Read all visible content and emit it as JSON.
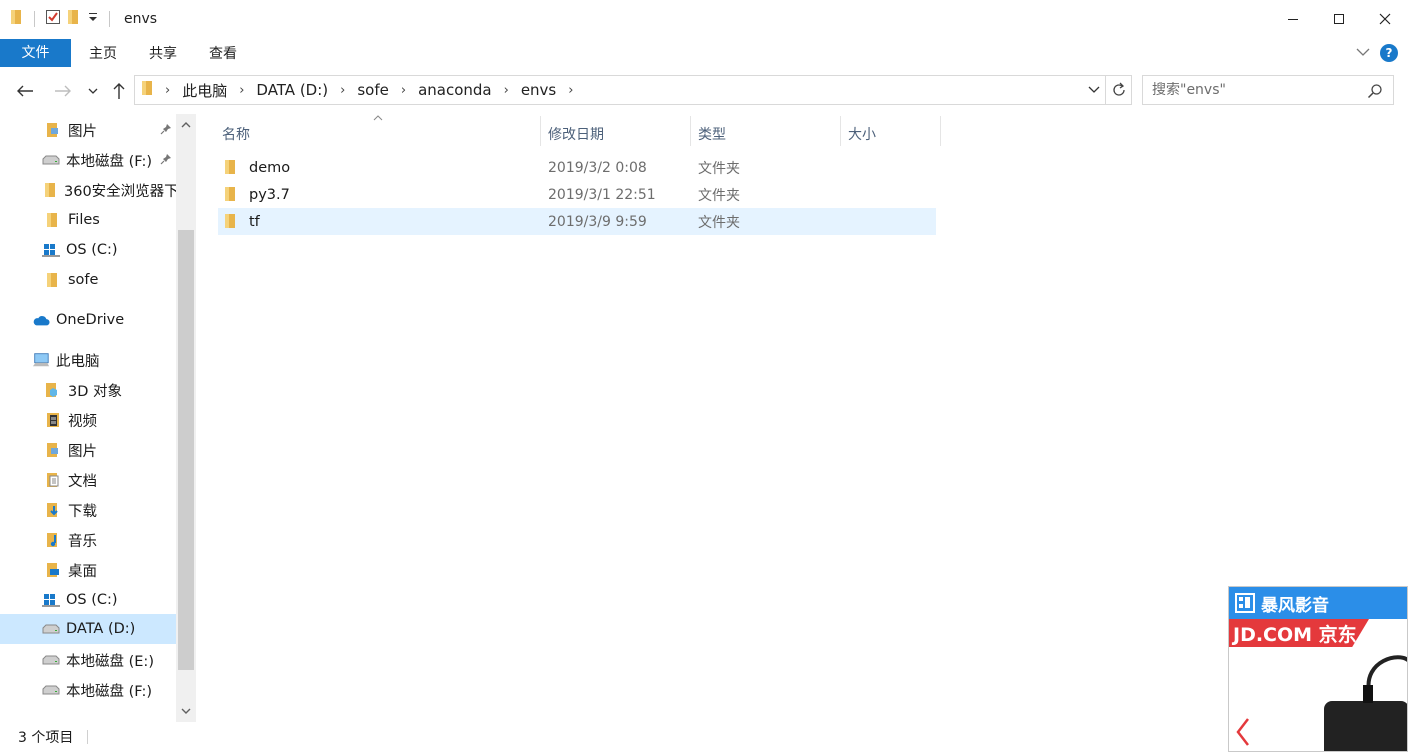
{
  "window": {
    "title": "envs"
  },
  "ribbon": {
    "tabs": [
      {
        "label": "文件"
      },
      {
        "label": "主页"
      },
      {
        "label": "共享"
      },
      {
        "label": "查看"
      }
    ]
  },
  "address": {
    "crumbs": [
      "此电脑",
      "DATA (D:)",
      "sofe",
      "anaconda",
      "envs"
    ]
  },
  "search": {
    "placeholder": "搜索\"envs\""
  },
  "nav": {
    "items": [
      {
        "label": "图片",
        "icon": "pictures-folder-icon",
        "pinned": true
      },
      {
        "label": "本地磁盘 (F:)",
        "icon": "drive-icon",
        "pinned": true
      },
      {
        "label": "360安全浏览器下",
        "icon": "folder-icon"
      },
      {
        "label": "Files",
        "icon": "folder-icon"
      },
      {
        "label": "OS (C:)",
        "icon": "windows-drive-icon"
      },
      {
        "label": "sofe",
        "icon": "folder-icon"
      },
      {
        "label": "OneDrive",
        "icon": "onedrive-cloud-icon"
      },
      {
        "label": "此电脑",
        "icon": "this-pc-icon"
      },
      {
        "label": "3D 对象",
        "icon": "3d-objects-icon"
      },
      {
        "label": "视频",
        "icon": "videos-icon"
      },
      {
        "label": "图片",
        "icon": "pictures-folder-icon"
      },
      {
        "label": "文档",
        "icon": "documents-icon"
      },
      {
        "label": "下载",
        "icon": "downloads-icon"
      },
      {
        "label": "音乐",
        "icon": "music-icon"
      },
      {
        "label": "桌面",
        "icon": "desktop-icon"
      },
      {
        "label": "OS (C:)",
        "icon": "windows-drive-icon"
      },
      {
        "label": "DATA (D:)",
        "icon": "drive-icon",
        "selected": true
      },
      {
        "label": "本地磁盘 (E:)",
        "icon": "drive-icon"
      },
      {
        "label": "本地磁盘 (F:)",
        "icon": "drive-icon"
      }
    ]
  },
  "columns": {
    "name": "名称",
    "date": "修改日期",
    "type": "类型",
    "size": "大小"
  },
  "files": [
    {
      "name": "demo",
      "date": "2019/3/2 0:08",
      "type": "文件夹"
    },
    {
      "name": "py3.7",
      "date": "2019/3/1 22:51",
      "type": "文件夹"
    },
    {
      "name": "tf",
      "date": "2019/3/9 9:59",
      "type": "文件夹"
    }
  ],
  "status": {
    "item_count": "3 个项目"
  },
  "ad": {
    "brand": "暴风影音",
    "band": "JD.COM 京东"
  },
  "colors": {
    "accent": "#1979ca",
    "folder": "#e8b44a",
    "selected_nav": "#cce8ff",
    "selected_row": "#e5f3ff"
  }
}
